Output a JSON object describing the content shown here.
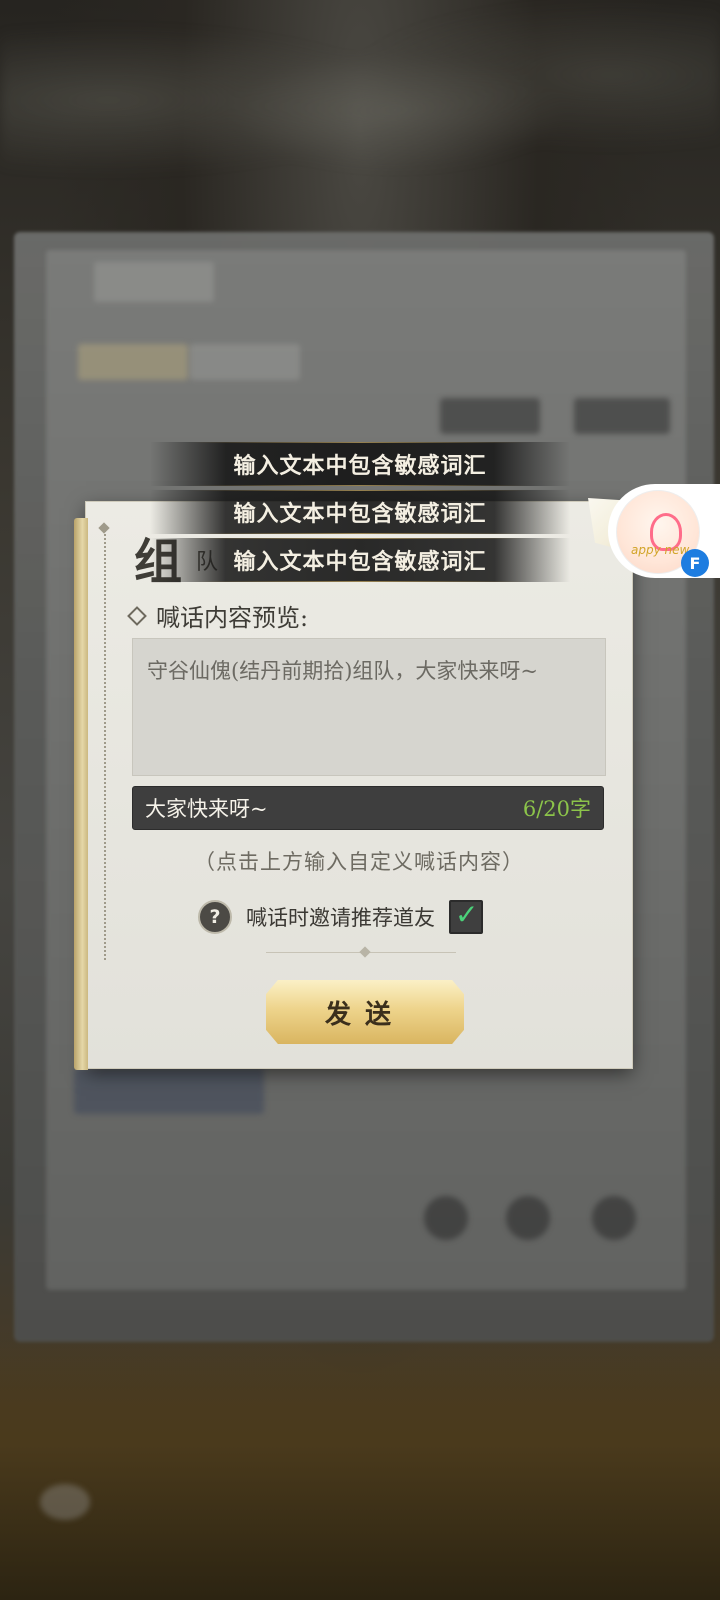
{
  "toasts": [
    "输入文本中包含敏感词汇",
    "输入文本中包含敏感词汇",
    "输入文本中包含敏感词汇"
  ],
  "dialog": {
    "title_big": "组",
    "title_small": "队",
    "preview_heading": "喊话内容预览:",
    "preview_text": "守谷仙傀(结丹前期拾)组队，大家快来呀~",
    "input_value": "大家快来呀~",
    "char_count": "6/20字",
    "hint": "（点击上方输入自定义喊话内容）",
    "invite_label": "喊话时邀请推荐道友",
    "invite_checked": true,
    "send_label": "发送"
  },
  "floating_widget": {
    "text": "appy new",
    "badge": "F"
  },
  "colors": {
    "count_color": "#8cc44a",
    "check_color": "#4bd17a"
  }
}
